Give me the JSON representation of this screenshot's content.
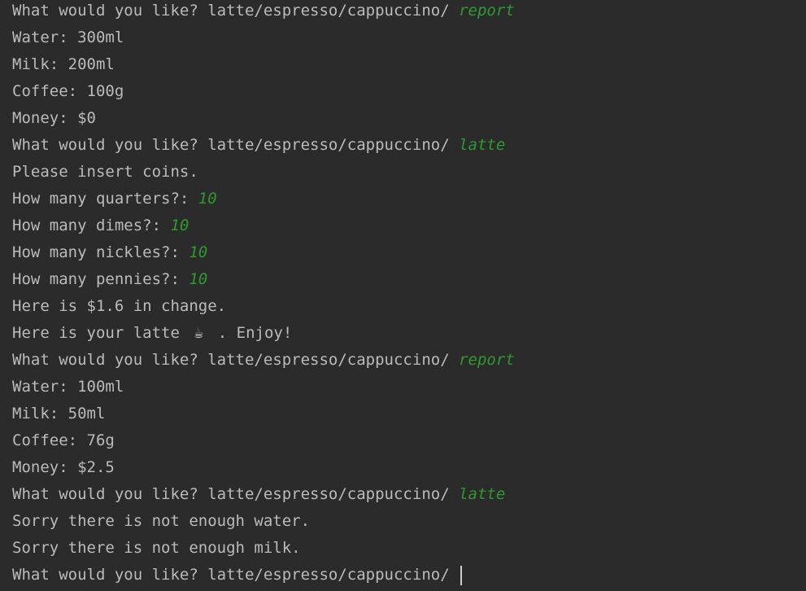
{
  "lines": [
    {
      "text": "What would you like? latte/espresso/cappuccino/ ",
      "input": "report"
    },
    {
      "text": "Water: 300ml"
    },
    {
      "text": "Milk: 200ml"
    },
    {
      "text": "Coffee: 100g"
    },
    {
      "text": "Money: $0"
    },
    {
      "text": "What would you like? latte/espresso/cappuccino/ ",
      "input": "latte"
    },
    {
      "text": "Please insert coins."
    },
    {
      "text": "How many quarters?: ",
      "input": "10"
    },
    {
      "text": "How many dimes?: ",
      "input": "10"
    },
    {
      "text": "How many nickles?: ",
      "input": "10"
    },
    {
      "text": "How many pennies?: ",
      "input": "10"
    },
    {
      "text": "Here is $1.6 in change."
    },
    {
      "text": "Here is your latte ",
      "emoji": "☕",
      "after": " . Enjoy!"
    },
    {
      "text": "What would you like? latte/espresso/cappuccino/ ",
      "input": "report"
    },
    {
      "text": "Water: 100ml"
    },
    {
      "text": "Milk: 50ml"
    },
    {
      "text": "Coffee: 76g"
    },
    {
      "text": "Money: $2.5"
    },
    {
      "text": "What would you like? latte/espresso/cappuccino/ ",
      "input": "latte"
    },
    {
      "text": "Sorry there is not enough water."
    },
    {
      "text": "Sorry there is not enough milk."
    },
    {
      "text": "What would you like? latte/espresso/cappuccino/ "
    }
  ],
  "colors": {
    "background": "#2b2b2b",
    "output_text": "#bbbbbb",
    "user_input": "#2e9a2e"
  }
}
